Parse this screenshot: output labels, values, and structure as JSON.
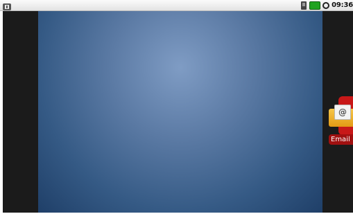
{
  "status_bar": {
    "time": "09:36",
    "icons": [
      "usb-debug-icon",
      "sim-icon",
      "battery-icon",
      "alarm-icon"
    ],
    "colors": {
      "battery": "#1fa31f"
    }
  },
  "home": {
    "wallpaper_colors": [
      "#7f9cc4",
      "#1f3f68"
    ],
    "shortcuts": [
      {
        "label": "Email",
        "icon": "email-icon"
      }
    ]
  }
}
